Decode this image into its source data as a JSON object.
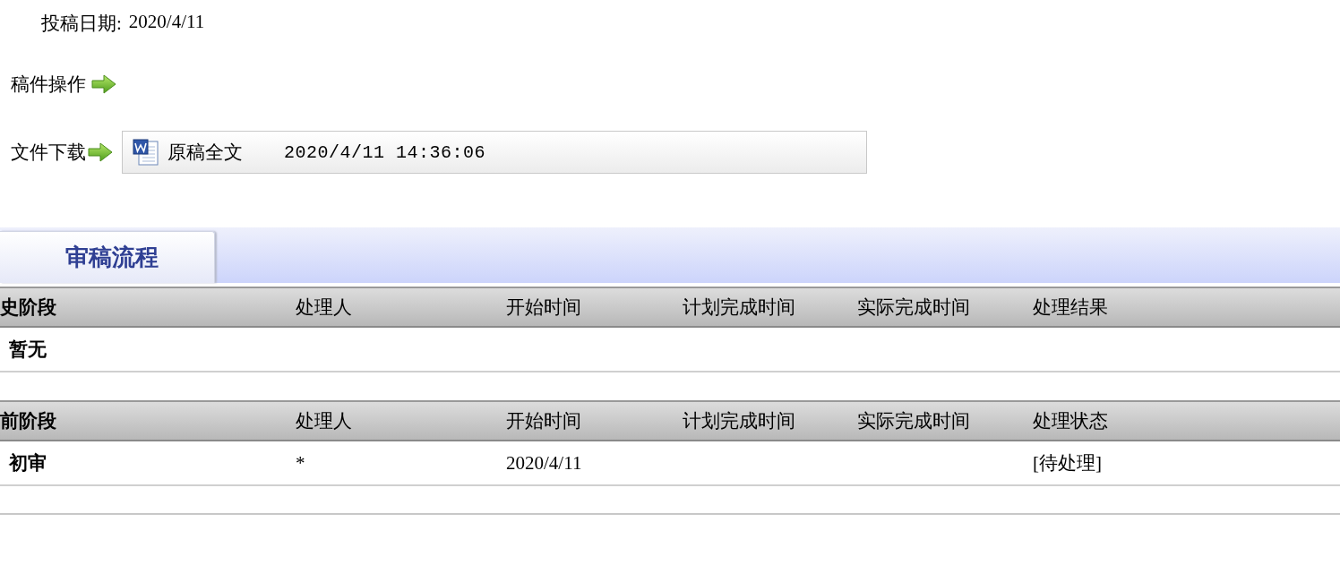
{
  "submission_date": {
    "label": "投稿日期:",
    "value": "2020/4/11"
  },
  "manuscript_actions": {
    "label": "稿件操作"
  },
  "file_download": {
    "label": "文件下载",
    "files": [
      {
        "name": "原稿全文",
        "time": "2020/4/11 14:36:06"
      }
    ]
  },
  "section_tab": {
    "label": "审稿流程"
  },
  "tables": [
    {
      "columns": [
        "史阶段",
        "处理人",
        "开始时间",
        "计划完成时间",
        "实际完成时间",
        "处理结果"
      ],
      "rows": [
        {
          "stage": "暂无"
        }
      ]
    },
    {
      "columns": [
        "前阶段",
        "处理人",
        "开始时间",
        "计划完成时间",
        "实际完成时间",
        "处理状态"
      ],
      "rows": [
        {
          "stage": "初审",
          "handler": "*",
          "start": "2020/4/11",
          "status": "[待处理]"
        }
      ]
    }
  ]
}
